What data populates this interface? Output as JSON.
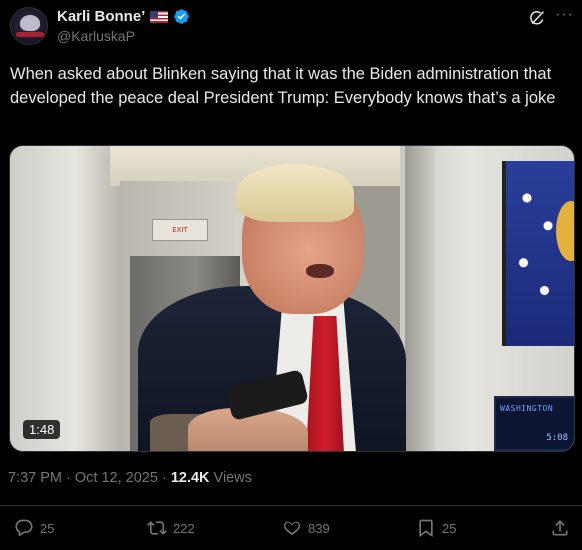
{
  "author": {
    "display_name": "Karli Bonne’",
    "handle": "@KarluskaP"
  },
  "tweet": {
    "text": "When asked about Blinken saying that it was the Biden administration that developed the peace deal President Trump: Everybody knows that’s a joke"
  },
  "media": {
    "duration": "1:48",
    "exit_sign": "EXIT",
    "tv_text_1": "WASHINGTON",
    "tv_text_2": "5:08"
  },
  "meta": {
    "time": "7:37 PM",
    "date": "Oct 12, 2025",
    "views_count": "12.4K",
    "views_label": "Views"
  },
  "actions": {
    "replies": "25",
    "reposts": "222",
    "likes": "839",
    "bookmarks": "25"
  },
  "colors": {
    "background": "#000000",
    "text_primary": "#e7e9ea",
    "text_secondary": "#71767b",
    "verified_blue": "#1d9bf0",
    "divider": "#2f3336"
  },
  "icons": {
    "verified": "verified-badge-icon",
    "flag": "us-flag-icon",
    "grok": "grok-icon",
    "more": "more-icon",
    "reply": "reply-icon",
    "repost": "repost-icon",
    "like": "like-icon",
    "bookmark": "bookmark-icon",
    "share": "share-icon"
  }
}
